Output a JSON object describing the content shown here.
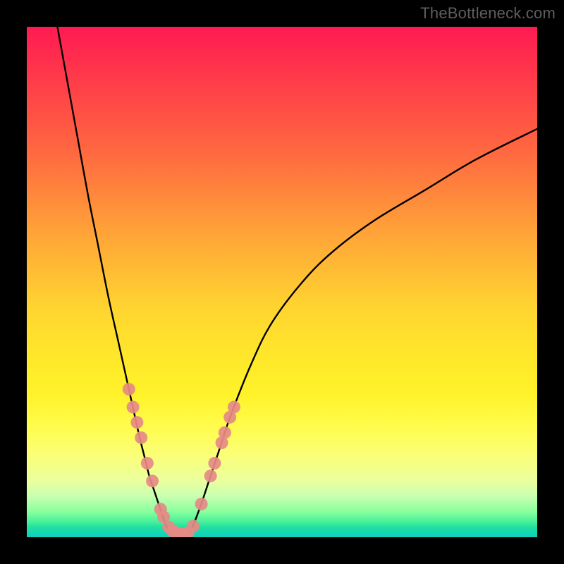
{
  "attribution": "TheBottleneck.com",
  "chart_data": {
    "type": "line",
    "title": "",
    "xlabel": "",
    "ylabel": "",
    "xlim": [
      0,
      100
    ],
    "ylim": [
      0,
      100
    ],
    "series": [
      {
        "name": "left-branch",
        "x": [
          6,
          8,
          10,
          12,
          14,
          16,
          18,
          20,
          22,
          23,
          24,
          25,
          26,
          27,
          28
        ],
        "y": [
          100,
          89,
          78,
          67,
          57,
          47,
          38,
          29,
          20,
          16,
          12,
          9,
          6,
          3,
          1
        ]
      },
      {
        "name": "valley-floor",
        "x": [
          28,
          29,
          30,
          31,
          32
        ],
        "y": [
          1,
          0.5,
          0.5,
          0.5,
          1
        ]
      },
      {
        "name": "right-branch",
        "x": [
          32,
          34,
          36,
          38,
          40,
          44,
          48,
          54,
          60,
          68,
          78,
          88,
          100
        ],
        "y": [
          1,
          6,
          12,
          18,
          24,
          34,
          42,
          50,
          56,
          62,
          68,
          74,
          80
        ]
      }
    ],
    "markers": [
      {
        "name": "left-branch-dots",
        "x": [
          20.0,
          20.8,
          21.6,
          22.4,
          23.6,
          24.6,
          26.2,
          26.8,
          27.8,
          28.6,
          29.4,
          30.0
        ],
        "y": [
          29.0,
          25.5,
          22.5,
          19.5,
          14.5,
          11.0,
          5.5,
          4.0,
          2.0,
          1.2,
          0.8,
          0.6
        ]
      },
      {
        "name": "right-branch-dots",
        "x": [
          30.8,
          31.6,
          32.6,
          34.2,
          36.0,
          36.8,
          38.2,
          38.8,
          39.8,
          40.6
        ],
        "y": [
          0.6,
          0.9,
          2.2,
          6.5,
          12.0,
          14.5,
          18.5,
          20.5,
          23.5,
          25.5
        ]
      }
    ]
  }
}
